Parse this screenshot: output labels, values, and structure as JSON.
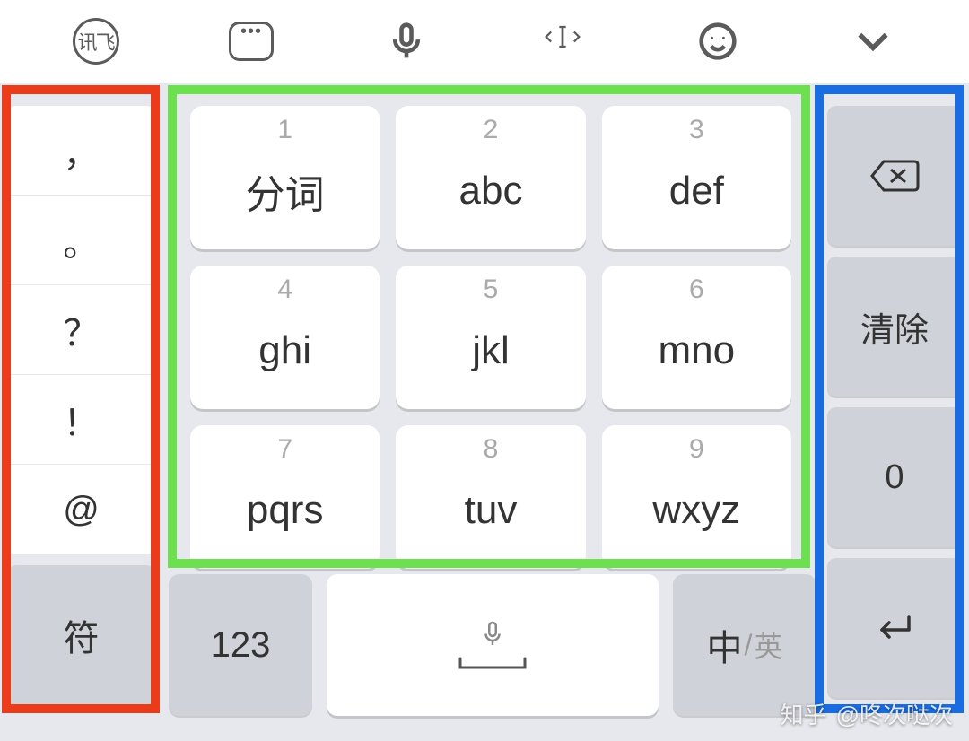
{
  "toolbar": {
    "ifly_label": "讯飞"
  },
  "left_punct": [
    "，",
    "。",
    "？",
    "！",
    "@"
  ],
  "sym_label": "符",
  "keypad": [
    {
      "num": "1",
      "label": "分词"
    },
    {
      "num": "2",
      "label": "abc"
    },
    {
      "num": "3",
      "label": "def"
    },
    {
      "num": "4",
      "label": "ghi"
    },
    {
      "num": "5",
      "label": "jkl"
    },
    {
      "num": "6",
      "label": "mno"
    },
    {
      "num": "7",
      "label": "pqrs"
    },
    {
      "num": "8",
      "label": "tuv"
    },
    {
      "num": "9",
      "label": "wxyz"
    }
  ],
  "right_actions": {
    "clear": "清除",
    "zero": "0"
  },
  "bottom": {
    "num_mode": "123",
    "lang_zh": "中",
    "lang_sep": "/",
    "lang_en": "英"
  },
  "watermark": {
    "site": "知乎",
    "user": "@咚次哒次"
  }
}
